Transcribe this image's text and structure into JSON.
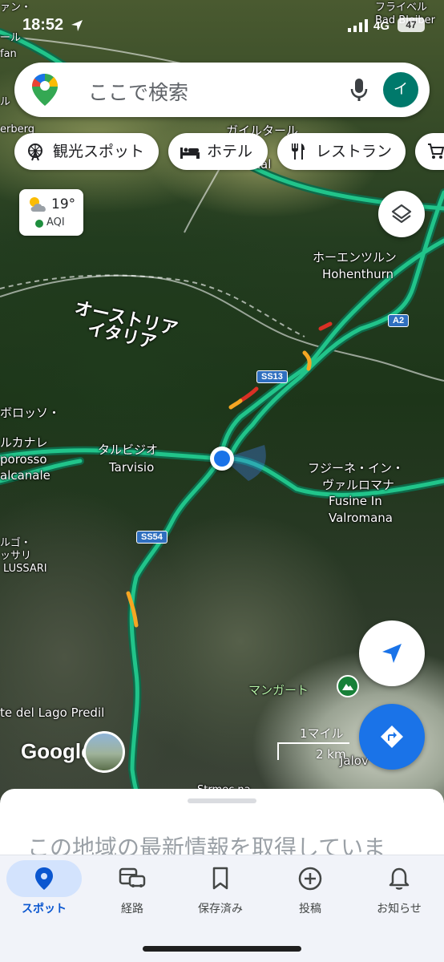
{
  "status_bar": {
    "time": "18:52",
    "network": "4G",
    "battery": "47"
  },
  "search": {
    "placeholder": "ここで検索",
    "avatar_initial": "イ"
  },
  "chips": [
    {
      "label": "観光スポット",
      "icon": "ferris-wheel-icon"
    },
    {
      "label": "ホテル",
      "icon": "bed-icon"
    },
    {
      "label": "レストラン",
      "icon": "fork-knife-icon"
    }
  ],
  "weather": {
    "temp": "19°",
    "aqi": "AQI",
    "aqi_color": "#1e8e3e"
  },
  "map": {
    "labels": {
      "top_right_1": "フライベル",
      "top_right_2": "Bad Bleiber",
      "top_left_1": "ァン・",
      "top_left_2": "ール",
      "top_left_3": "fan",
      "left_mid_1": "ル",
      "left_mid_2": "erberg",
      "gailtal_jp": "ガイルタール",
      "gailtal": "Gailtal",
      "hohenthurn_jp": "ホーエンツルン",
      "hohenthurn": "Hohenthurn",
      "border_at": "オーストリア",
      "border_it": "イタリア",
      "malborghetto_1": "ボロッソ・",
      "malborghetto_2": "ルカナレ",
      "malborghetto_3": "porosso",
      "malborghetto_4": "alcanale",
      "tarvisio_jp": "タルビジオ",
      "tarvisio": "Tarvisio",
      "fusine_jp_1": "フジーネ・イン・",
      "fusine_jp_2": "ヴァルロマナ",
      "fusine_1": "Fusine In",
      "fusine_2": "Valromana",
      "lussari_1": "ルゴ・",
      "lussari_2": "ッサリ",
      "lussari_3": "LUSSARI",
      "mangart": "マンガート",
      "lago_predil": "te del Lago Predil",
      "strmec": "Strmec na",
      "jalovec": "Jalov"
    },
    "shields": {
      "a2": "A2",
      "ss13": "SS13",
      "ss54": "SS54"
    },
    "logo": "Google",
    "scale": {
      "imperial": "1マイル",
      "metric": "2 km"
    }
  },
  "sheet": {
    "message": "この地域の最新情報を取得していま"
  },
  "nav": [
    {
      "label": "スポット",
      "icon": "location-pin-icon",
      "active": true
    },
    {
      "label": "経路",
      "icon": "commute-icon",
      "active": false
    },
    {
      "label": "保存済み",
      "icon": "bookmark-icon",
      "active": false
    },
    {
      "label": "投稿",
      "icon": "add-circle-icon",
      "active": false
    },
    {
      "label": "お知らせ",
      "icon": "bell-icon",
      "active": false
    }
  ],
  "colors": {
    "accent": "#1a73e8",
    "traffic_green": "#21c48a",
    "traffic_orange": "#f5a623",
    "traffic_red": "#d93025"
  }
}
